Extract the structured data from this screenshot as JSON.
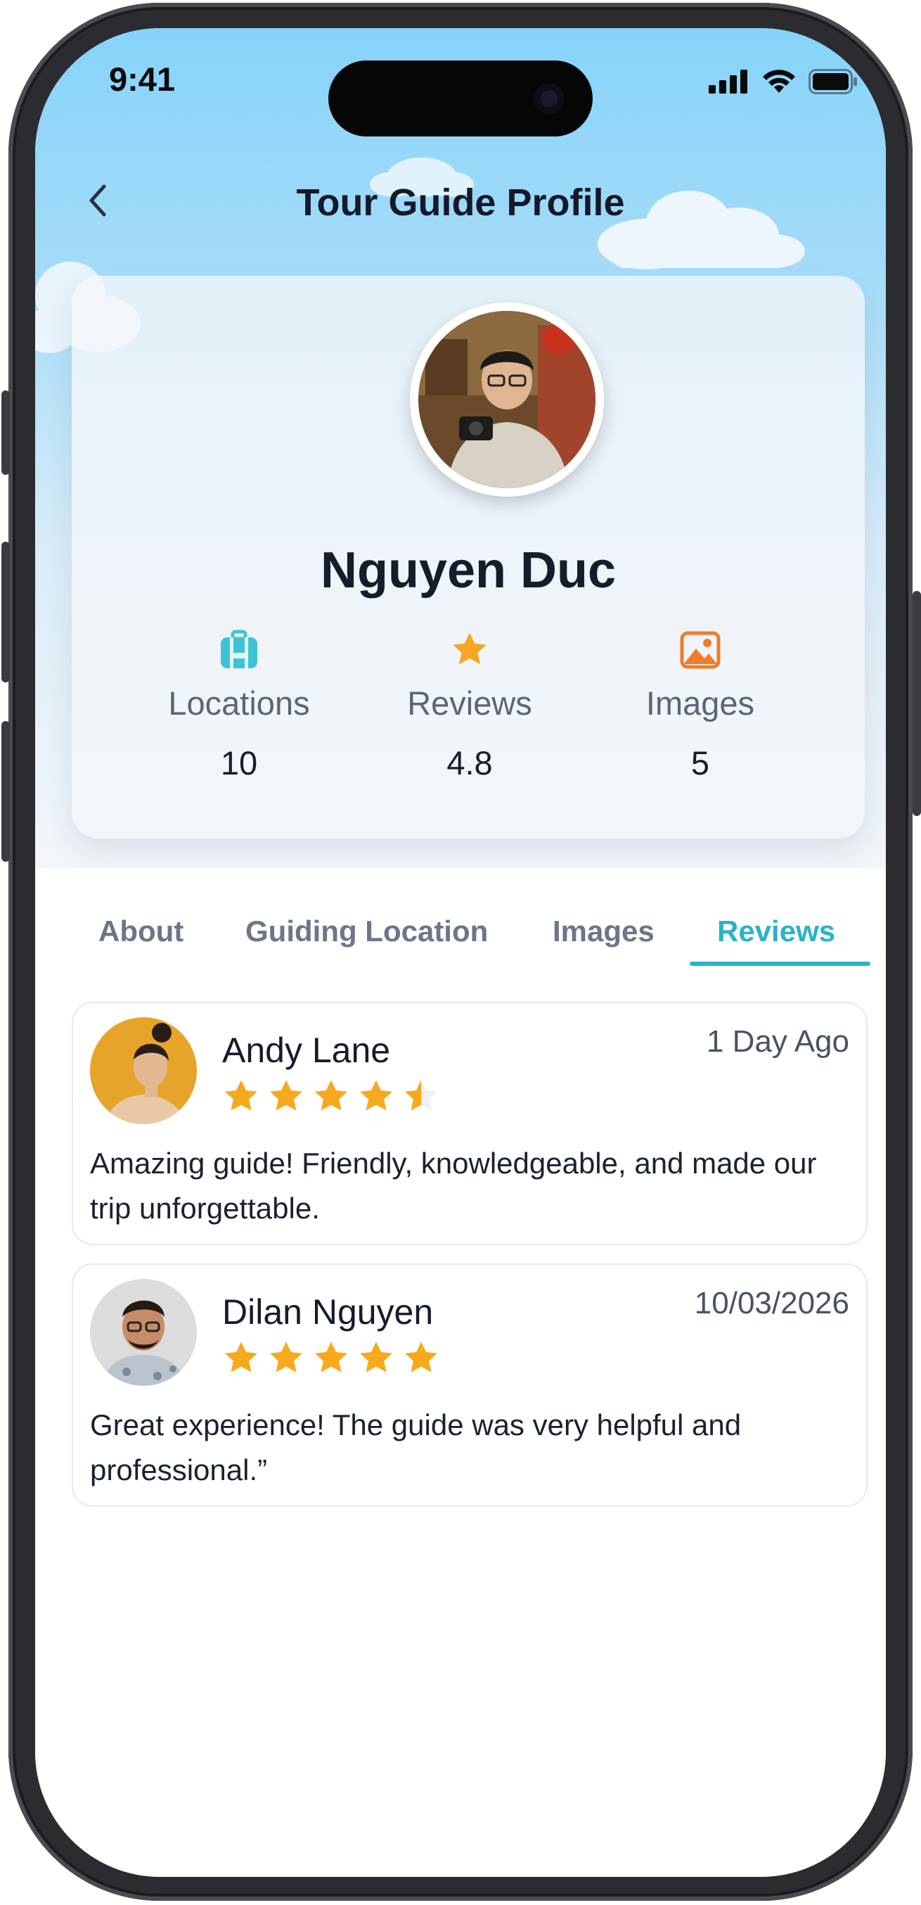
{
  "status_bar": {
    "time": "9:41"
  },
  "header": {
    "title": "Tour Guide Profile"
  },
  "profile": {
    "name": "Nguyen Duc",
    "stats": [
      {
        "icon": "suitcase-icon",
        "label": "Locations",
        "value": "10",
        "color": "#3ec3d4"
      },
      {
        "icon": "star-icon",
        "label": "Reviews",
        "value": "4.8",
        "color": "#f5a623"
      },
      {
        "icon": "image-icon",
        "label": "Images",
        "value": "5",
        "color": "#f07c2a"
      }
    ]
  },
  "tabs": [
    {
      "label": "About",
      "active": false
    },
    {
      "label": "Guiding Location",
      "active": false
    },
    {
      "label": "Images",
      "active": false
    },
    {
      "label": "Reviews",
      "active": true
    }
  ],
  "reviews": [
    {
      "author": "Andy Lane",
      "date": "1 Day Ago",
      "rating": 4.5,
      "text": "Amazing guide! Friendly, knowledgeable, and made our trip unforgettable."
    },
    {
      "author": "Dilan Nguyen",
      "date": "10/03/2026",
      "rating": 5,
      "text": "Great experience! The guide was very helpful and professional.”"
    }
  ],
  "colors": {
    "accent": "#2ab3c6",
    "star": "#f7a91e",
    "title": "#141a2a"
  }
}
